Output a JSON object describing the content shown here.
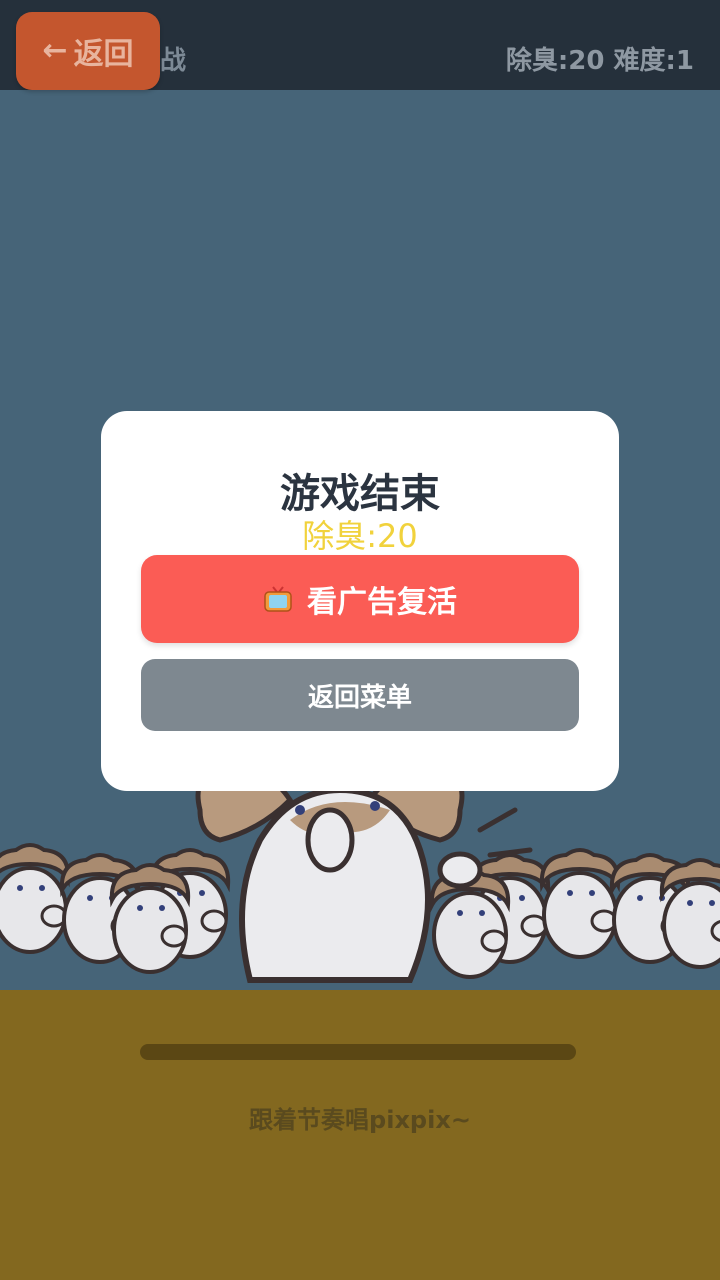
{
  "header": {
    "back_label": "返回",
    "back_icon": "left-arrow-icon",
    "title_fragment": "战",
    "stats": "除臭:20 难度:1"
  },
  "modal": {
    "title": "游戏结束",
    "score": "除臭:20",
    "revive_label": "看广告复活",
    "revive_icon": "tv-icon",
    "menu_label": "返回菜单"
  },
  "footer": {
    "hint": "跟着节奏唱pixpix~",
    "progress_fraction": 0.0
  },
  "colors": {
    "sky": "#466478",
    "ground": "#83681f",
    "revive_button": "#fb5c55",
    "menu_button": "#7e8890",
    "score_text": "#f1d23c"
  }
}
